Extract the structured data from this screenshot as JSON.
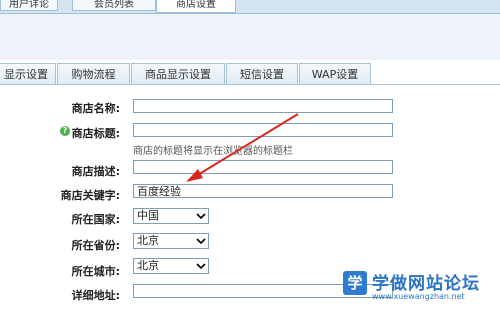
{
  "top_tabs": [
    {
      "label": "用户详论"
    },
    {
      "label": "会员列表"
    },
    {
      "label": "商店设置"
    }
  ],
  "sub_tabs": [
    {
      "label": "显示设置"
    },
    {
      "label": "购物流程"
    },
    {
      "label": "商品显示设置"
    },
    {
      "label": "短信设置"
    },
    {
      "label": "WAP设置"
    }
  ],
  "form": {
    "shop_name": {
      "label": "商店名称:",
      "value": ""
    },
    "shop_title": {
      "label": "商店标题:",
      "value": "",
      "hint": "商店的标题将显示在浏览器的标题栏"
    },
    "shop_desc": {
      "label": "商店描述:",
      "value": ""
    },
    "shop_keywords": {
      "label": "商店关键字:",
      "value": "百度经验"
    },
    "country": {
      "label": "所在国家:",
      "value": "中国"
    },
    "province": {
      "label": "所在省份:",
      "value": "北京"
    },
    "city": {
      "label": "所在城市:",
      "value": "北京"
    },
    "address": {
      "label": "详细地址:",
      "value": ""
    }
  },
  "watermark": {
    "logo_char": "学",
    "title": "学做网站论坛",
    "url": "www.xuewangzhan.net"
  },
  "colors": {
    "arrow": "#d9241b",
    "accent": "#2a73c6"
  }
}
